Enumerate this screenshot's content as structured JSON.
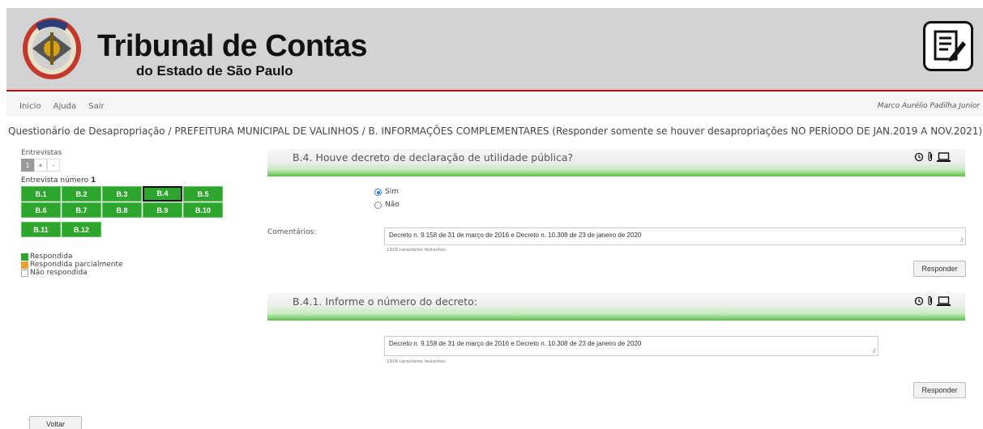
{
  "header": {
    "brand_title": "Tribunal de Contas",
    "brand_subtitle": "do Estado de São Paulo",
    "logo": "tce-seal-logo",
    "action_icon": "document-edit-icon",
    "accent_color": "#d20000"
  },
  "nav": {
    "links": [
      "Inicio",
      "Ajuda",
      "Sair"
    ],
    "user": "Marco Aurélio Padilha Junior"
  },
  "breadcrumb": "Questionário de Desapropriação / PREFEITURA MUNICIPAL DE VALINHOS / B. INFORMAÇÕES COMPLEMENTARES (Responder somente se houver desapropriações NO PERÍODO DE JAN.2019 A NOV.2021)",
  "sidebar": {
    "interviews_label": "Entrevistas",
    "pager": [
      "1",
      "+",
      "-"
    ],
    "interview_prefix": "Entrevista número",
    "interview_number": "1",
    "cells": [
      "B.1",
      "B.2",
      "B.3",
      "B.4",
      "B.5",
      "B.6",
      "B.7",
      "B.8",
      "B.9",
      "B.10",
      "B.11",
      "B.12"
    ],
    "current_cell": "B.4",
    "legend": [
      {
        "label": "Respondida",
        "color": "#2ea62e"
      },
      {
        "label": "Respondida parcialmente",
        "color": "#f0a030"
      },
      {
        "label": "Não respondida",
        "color": "#ffffff"
      }
    ]
  },
  "q1": {
    "title": "B.4. Houve decreto de declaração de utilidade pública?",
    "options": [
      "Sim",
      "Não"
    ],
    "selected": "Sim",
    "comment_label": "Comentários:",
    "comment_value": "Decreto n. 9.158 de 31 de março de 2016 e Decreto n. 10.308 de 23 de janeiro de 2020",
    "remaining": "1916 caracteres restantes.",
    "button": "Responder"
  },
  "q2": {
    "title": "B.4.1. Informe o número do decreto:",
    "answer_value": "Decreto n. 9.158 de 31 de março de 2016 e Decreto n. 10.308 de 23 de janeiro de 2020",
    "remaining": "1916 caracteres restantes.",
    "button": "Responder"
  },
  "panel_icons": [
    "history-icon",
    "attachment-icon",
    "laptop-icon"
  ],
  "back_button": "Voltar"
}
